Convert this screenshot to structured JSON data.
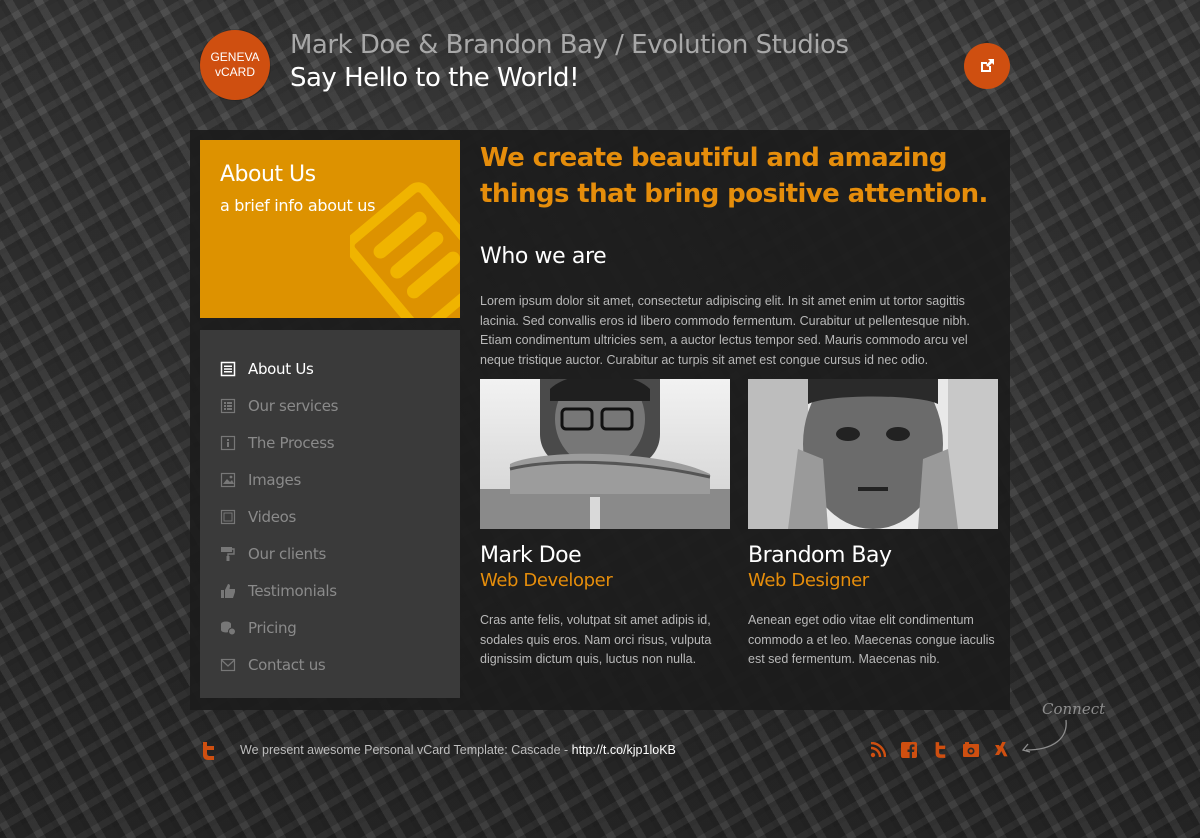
{
  "header": {
    "logo_line1": "GENEVA",
    "logo_line2": "vCARD",
    "title": "Mark Doe & Brandon Bay / Evolution Studios",
    "subtitle": "Say Hello to the World!",
    "external_icon": "external-link-icon"
  },
  "about_box": {
    "title": "About Us",
    "subtitle": "a brief info about us",
    "icon": "document-icon"
  },
  "nav": {
    "items": [
      {
        "label": "About Us",
        "icon": "document-icon",
        "active": true
      },
      {
        "label": "Our services",
        "icon": "list-icon"
      },
      {
        "label": "The Process",
        "icon": "info-icon"
      },
      {
        "label": "Images",
        "icon": "image-icon"
      },
      {
        "label": "Videos",
        "icon": "video-icon"
      },
      {
        "label": "Our clients",
        "icon": "paint-roller-icon"
      },
      {
        "label": "Testimonials",
        "icon": "thumbs-up-icon"
      },
      {
        "label": "Pricing",
        "icon": "coins-icon"
      },
      {
        "label": "Contact us",
        "icon": "mail-icon"
      }
    ]
  },
  "main": {
    "headline": "We create beautiful and amazing things that bring positive attention.",
    "section_title": "Who we are",
    "intro": "Lorem ipsum dolor sit amet, consectetur adipiscing elit. In sit amet enim ut tortor sagittis lacinia. Sed convallis eros id libero commodo fermentum. Curabitur ut pellentesque nibh. Etiam condimentum ultricies sem, a auctor lectus tempor sed. Mauris commodo arcu vel neque tristique auctor. Curabitur ac turpis sit amet est congue cursus id nec odio.",
    "team": [
      {
        "name": "Mark Doe",
        "role": "Web Developer",
        "desc": "Cras ante felis, volutpat sit amet adipis id, sodales quis eros. Nam orci risus, vulputa dignissim dictum quis, luctus non nulla."
      },
      {
        "name": "Brandom Bay",
        "role": "Web Designer",
        "desc": "Aenean eget odio vitae elit condimentum commodo a et leo. Maecenas congue iaculis est sed fermentum. Maecenas nib."
      }
    ]
  },
  "footer": {
    "tweet_text": "We present awesome Personal vCard Template: Cascade - ",
    "tweet_link": "http://t.co/kjp1loKB",
    "connect_label": "Connect",
    "social": [
      "rss-icon",
      "facebook-icon",
      "twitter-icon",
      "camera-icon",
      "xing-icon"
    ]
  },
  "colors": {
    "accent": "#cf4f10",
    "orange": "#e58d0b",
    "about_box": "#dd9200"
  }
}
